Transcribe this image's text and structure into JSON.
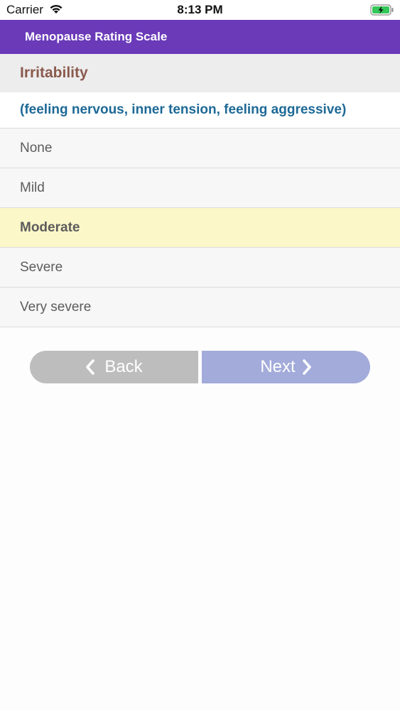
{
  "status_bar": {
    "carrier": "Carrier",
    "time": "8:13 PM",
    "wifi_icon": "wifi-icon",
    "battery_icon": "battery-charging-icon"
  },
  "nav": {
    "title": "Menopause Rating Scale",
    "color": "#6a3ab9"
  },
  "question": {
    "title": "Irritability",
    "description": "(feeling nervous, inner tension, feeling aggressive)"
  },
  "options": [
    {
      "label": "None",
      "selected": false
    },
    {
      "label": "Mild",
      "selected": false
    },
    {
      "label": "Moderate",
      "selected": true
    },
    {
      "label": "Severe",
      "selected": false
    },
    {
      "label": "Very severe",
      "selected": false
    }
  ],
  "buttons": {
    "back_label": "Back",
    "next_label": "Next",
    "back_icon": "chevron-left-icon",
    "next_icon": "chevron-right-icon"
  },
  "colors": {
    "selected_row": "#fcf7c9",
    "back_button": "#bdbdbd",
    "next_button": "#a2abda",
    "title": "#8a5a4d",
    "description": "#1d6996"
  }
}
